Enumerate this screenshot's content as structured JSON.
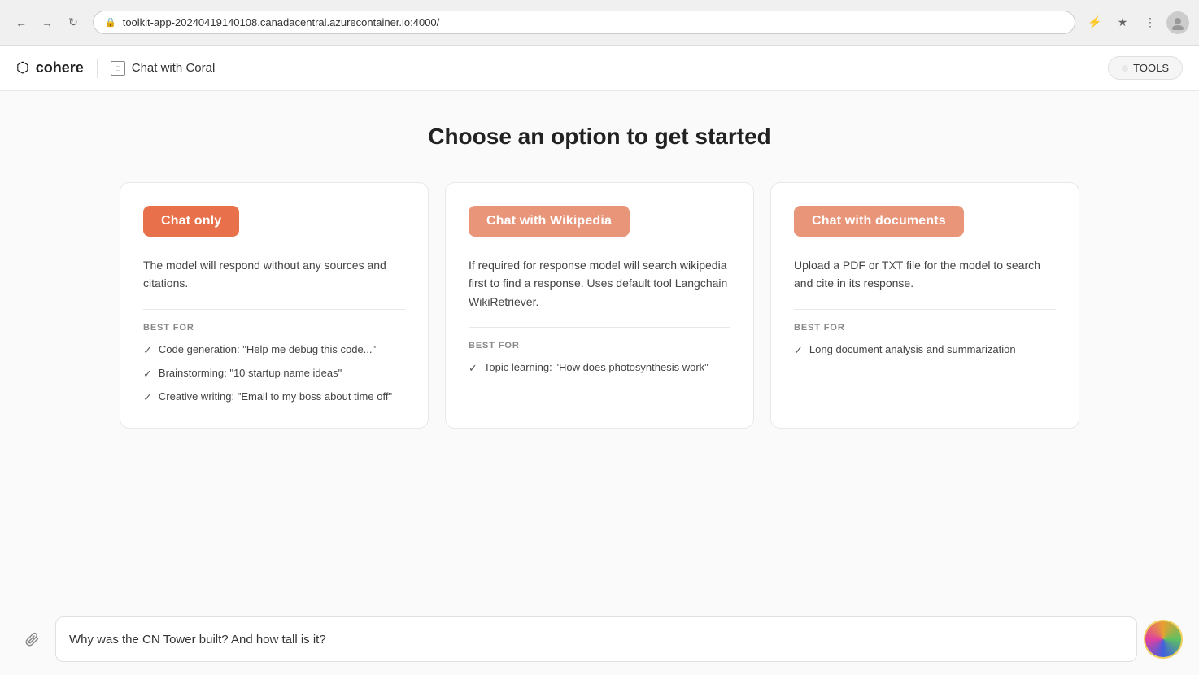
{
  "browser": {
    "url": "toolkit-app-20240419140108.canadacentral.azurecontainer.io:4000/",
    "lock_icon": "🔒"
  },
  "nav": {
    "logo_icon": "⬡",
    "logo_text": "cohere",
    "chat_title": "Chat with Coral",
    "tools_label": "TOOLS"
  },
  "main": {
    "page_title": "Choose an option to get started",
    "cards": [
      {
        "button_label": "Chat only",
        "description": "The model will respond without any sources and citations.",
        "best_for_label": "BEST FOR",
        "items": [
          "Code generation: \"Help me debug this code...\"",
          "Brainstorming: \"10 startup name ideas\"",
          "Creative writing: \"Email to my boss about time off\""
        ]
      },
      {
        "button_label": "Chat with Wikipedia",
        "description": "If required for response model will search wikipedia first to find a response. Uses default tool Langchain WikiRetriever.",
        "best_for_label": "BEST FOR",
        "items": [
          "Topic learning: \"How does photosynthesis work\""
        ]
      },
      {
        "button_label": "Chat with documents",
        "description": "Upload a PDF or TXT file for the model to search and cite in its response.",
        "best_for_label": "BEST FOR",
        "items": [
          "Long document analysis and summarization"
        ]
      }
    ]
  },
  "input": {
    "placeholder": "Why was the CN Tower built? And how tall is it?",
    "value": "Why was the CN Tower built? And how tall is it?"
  },
  "icons": {
    "attach": "📎",
    "send": "→",
    "back": "←",
    "forward": "→",
    "refresh": "↻",
    "check": "✓"
  }
}
